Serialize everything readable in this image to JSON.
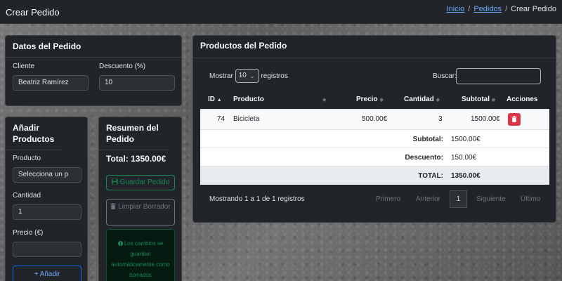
{
  "navbar": {
    "brand": "Crear Pedido",
    "breadcrumb": {
      "home": "Inicio",
      "orders": "Pedidos",
      "current": "Crear Pedido",
      "separator": "/"
    }
  },
  "order_data": {
    "title": "Datos del Pedido",
    "client_label": "Cliente",
    "client_value": "Beatriz Ramírez",
    "discount_label": "Descuento (%)",
    "discount_value": "10"
  },
  "add_products": {
    "title": "Añadir Productos",
    "product_label": "Producto",
    "product_placeholder": "Selecciona un p",
    "quantity_label": "Cantidad",
    "quantity_value": "1",
    "price_label": "Precio (€)",
    "price_value": "",
    "add_button": "+ Añadir"
  },
  "summary": {
    "title": "Resumen del Pedido",
    "total": "Total: 1350.00€",
    "save_button": "Guardar Pedido",
    "clear_button": "Limpiar Borrador",
    "alert": "Los cambios se guardan automáticamente como borrados"
  },
  "products_table": {
    "title": "Productos del Pedido",
    "show_label": "Mostrar",
    "page_length": "10",
    "records_label": "registros",
    "search_label": "Buscar:",
    "search_value": "",
    "columns": [
      "ID",
      "Producto",
      "Precio",
      "Cantidad",
      "Subtotal",
      "Acciones"
    ],
    "rows": [
      {
        "id": "74",
        "product": "Bicicleta",
        "price": "500.00€",
        "quantity": "3",
        "subtotal": "1500.00€"
      }
    ],
    "footer": {
      "subtotal_label": "Subtotal:",
      "subtotal_value": "1500.00€",
      "discount_label": "Descuento:",
      "discount_value": "150.00€",
      "total_label": "TOTAL:",
      "total_value": "1350.00€"
    },
    "info": "Mostrando 1 a 1 de 1 registros",
    "pagination": {
      "first": "Primero",
      "previous": "Anterior",
      "current": "1",
      "next": "Siguiente",
      "last": "Último"
    }
  },
  "colors": {
    "navbar_bg": "#212529",
    "card_bg": "#212529",
    "primary": "#0d6efd",
    "success": "#198754",
    "danger": "#dc3545",
    "link": "#6ea8fe"
  },
  "icons": [
    "save-icon",
    "trash-icon",
    "info-circle-icon",
    "sort-icon",
    "chevron-down-icon",
    "plus-icon"
  ]
}
